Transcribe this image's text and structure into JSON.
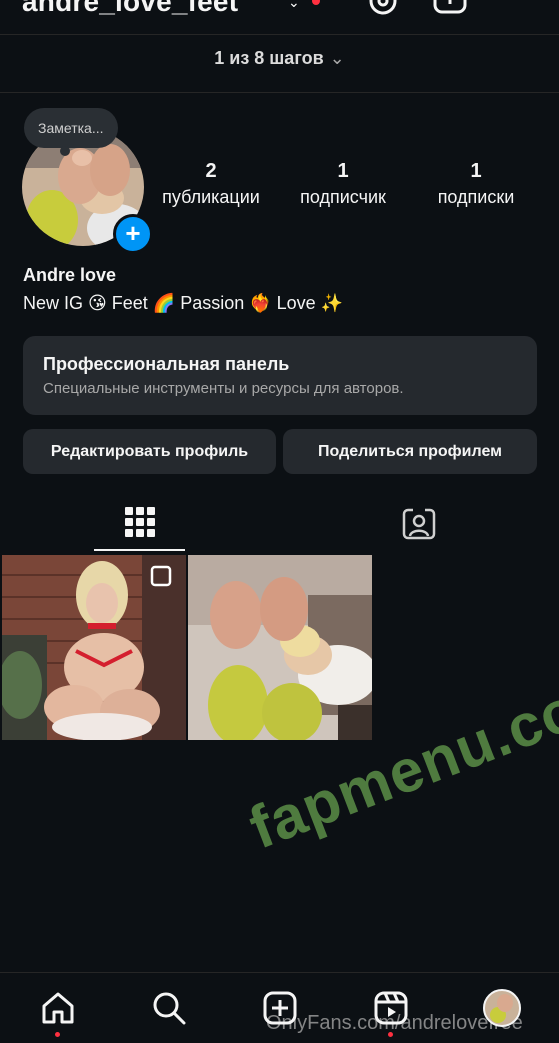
{
  "header": {
    "username": "andre_love_feet",
    "username_chevron": "⌄",
    "icons": [
      "threads-icon",
      "add-post-icon",
      "menu-icon"
    ]
  },
  "steps": {
    "label": "1 из 8 шагов",
    "chevron": "⌄"
  },
  "profile": {
    "note_placeholder": "Заметка...",
    "add_story_symbol": "+",
    "stats": [
      {
        "value": "2",
        "label": "публикации"
      },
      {
        "value": "1",
        "label": "подписчик"
      },
      {
        "value": "1",
        "label": "подписки"
      }
    ],
    "name": "Andre love",
    "bio": "New IG 😘 Feet 🌈 Passion ❤️‍🔥 Love ✨"
  },
  "pro_panel": {
    "title": "Профессиональная панель",
    "subtitle": "Специальные инструменты и ресурсы для авторов."
  },
  "buttons": {
    "edit_profile": "Редактировать профиль",
    "share_profile": "Поделиться профилем"
  },
  "tabs": [
    "grid-icon",
    "tagged-icon"
  ],
  "posts": [
    {
      "kind": "carousel"
    },
    {
      "kind": "single"
    }
  ],
  "overlays": {
    "watermark": "fapmenu.com",
    "onlyfans": "OnlyFans.com/andrelovefree"
  },
  "bottom_nav": [
    "home-icon",
    "search-icon",
    "create-icon",
    "reels-icon",
    "profile-avatar"
  ],
  "colors": {
    "background": "#0c1014",
    "panel": "#25292e",
    "accent_blue": "#0095f6",
    "notification_red": "#ff3040",
    "watermark_green": "#4f7b3f"
  }
}
